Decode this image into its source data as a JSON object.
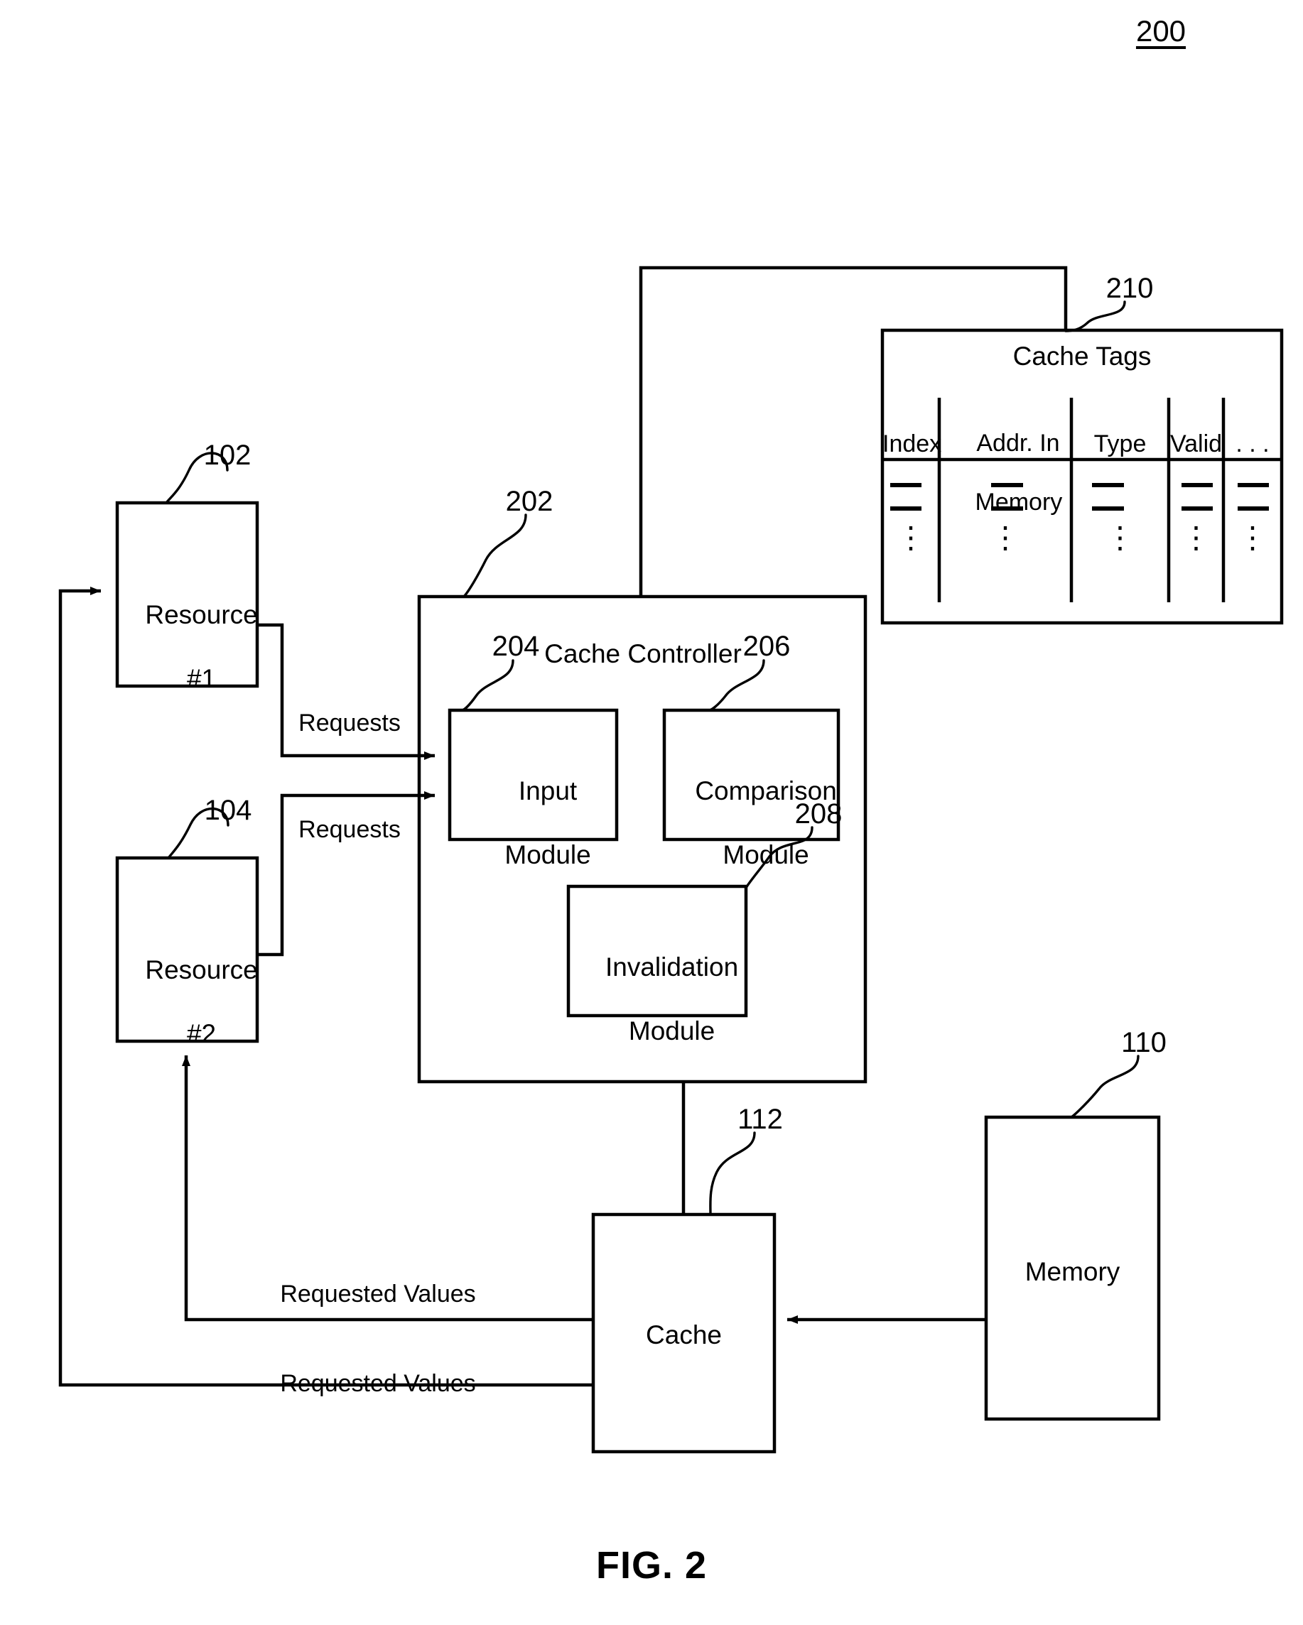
{
  "figure": {
    "number_label": "200",
    "caption": "FIG. 2"
  },
  "blocks": {
    "resource1": {
      "line1": "Resource",
      "line2": "#1",
      "ref": "102"
    },
    "resource2": {
      "line1": "Resource",
      "line2": "#2",
      "ref": "104"
    },
    "cache_controller": {
      "title": "Cache Controller",
      "ref": "202"
    },
    "input_module": {
      "line1": "Input",
      "line2": "Module",
      "ref": "204"
    },
    "comparison_module": {
      "line1": "Comparison",
      "line2": "Module",
      "ref": "206"
    },
    "invalidation_module": {
      "line1": "Invalidation",
      "line2": "Module",
      "ref": "208"
    },
    "cache": {
      "title": "Cache",
      "ref": "112"
    },
    "memory": {
      "title": "Memory",
      "ref": "110"
    },
    "cache_tags": {
      "title": "Cache Tags",
      "ref": "210"
    }
  },
  "cache_tags_table": {
    "columns": [
      {
        "header": "Index"
      },
      {
        "header_line1": "Addr. In",
        "header_line2": "Memory"
      },
      {
        "header": "Type"
      },
      {
        "header": "Valid"
      },
      {
        "header": ". . ."
      }
    ],
    "row_placeholder": "—",
    "vertical_ellipsis": "⋮"
  },
  "flow_labels": {
    "requests_1": "Requests",
    "requests_2": "Requests",
    "requested_values_1": "Requested Values",
    "requested_values_2": "Requested Values"
  },
  "colors": {
    "stroke": "#000000",
    "background": "#ffffff"
  }
}
